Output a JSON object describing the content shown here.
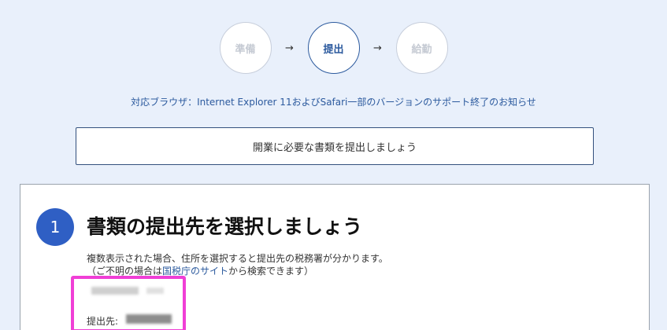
{
  "stepper": {
    "steps": [
      {
        "label": "準備",
        "active": false
      },
      {
        "label": "提出",
        "active": true
      },
      {
        "label": "給勤",
        "active": false
      }
    ],
    "arrow": "→"
  },
  "notice": {
    "text": "対応ブラウザ：Internet Explorer 11およびSafari一部のバージョンのサポート終了のお知らせ"
  },
  "banner": {
    "text": "開業に必要な書類を提出しましょう"
  },
  "section": {
    "number": "1",
    "title": "書類の提出先を選択しましょう",
    "desc_line1": "複数表示された場合、住所を選択すると提出先の税務署が分かります。",
    "desc_line2_prefix": "（ご不明の場合は",
    "desc_line2_link": "国税庁のサイト",
    "desc_line2_suffix": "から検索できます）",
    "office_label": "提出先:"
  },
  "colors": {
    "background": "#e9f0fb",
    "accent": "#2c5a9e",
    "badge": "#2f5fc4",
    "highlight": "#f03fd6"
  }
}
